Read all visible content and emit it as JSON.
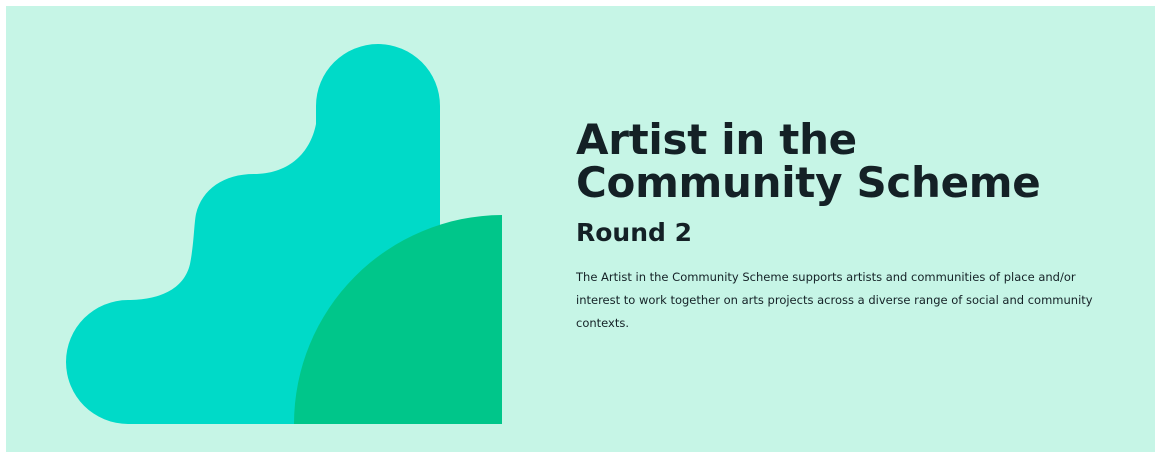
{
  "hero": {
    "title": "Artist in the Community Scheme",
    "subtitle": "Round 2",
    "description": "The Artist in the Community Scheme supports artists and communities of place and/or interest to work together on arts projects across a diverse range of social and community contexts."
  },
  "colors": {
    "background": "#c6f5e6",
    "shape_teal": "#00dac8",
    "shape_green": "#00c68a",
    "text": "#142126"
  },
  "illustration": {
    "icon": "abstract-shapes-illustration"
  }
}
